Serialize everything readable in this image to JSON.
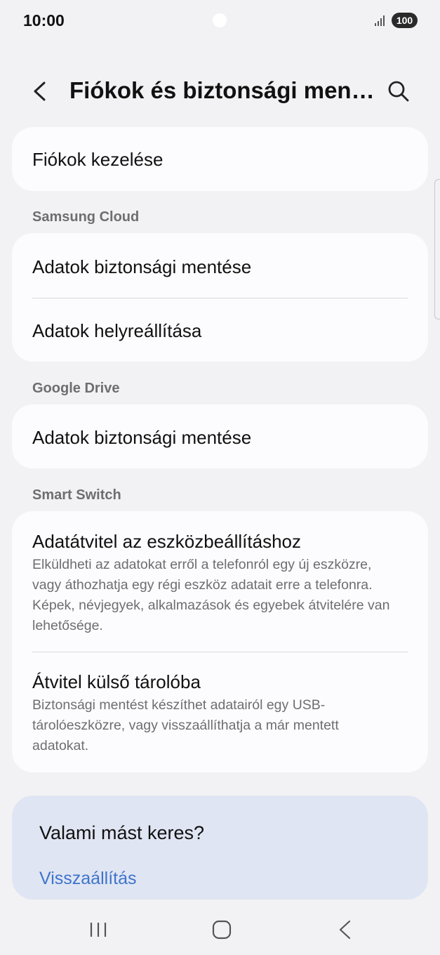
{
  "status_bar": {
    "time": "10:00",
    "battery": "100",
    "icons": [
      "signal-icon",
      "battery-icon"
    ]
  },
  "header": {
    "title": "Fiókok és biztonsági mentés",
    "back_icon": "chevron-left-icon",
    "search_icon": "search-icon"
  },
  "manage_card": {
    "title": "Fiókok kezelése"
  },
  "samsung_cloud": {
    "label": "Samsung Cloud",
    "items": [
      {
        "title": "Adatok biztonsági mentése"
      },
      {
        "title": "Adatok helyreállítása"
      }
    ]
  },
  "google_drive": {
    "label": "Google Drive",
    "items": [
      {
        "title": "Adatok biztonsági mentése"
      }
    ]
  },
  "smart_switch": {
    "label": "Smart Switch",
    "items": [
      {
        "title": "Adatátvitel az eszközbeállításhoz",
        "desc": "Elküldheti az adatokat erről a telefonról egy új eszközre, vagy áthozhatja egy régi eszköz adatait erre a telefonra. Képek, névjegyek, alkalmazások és egyebek átvitelére van lehetősége."
      },
      {
        "title": "Átvitel külső tárolóba",
        "desc": "Biztonsági mentést készíthet adatairól egy USB-tárolóeszközre, vagy visszaállíthatja a már mentett adatokat."
      }
    ]
  },
  "suggestion": {
    "title": "Valami mást keres?",
    "link": "Visszaállítás"
  },
  "nav_bar": {
    "buttons": [
      "recent-apps-icon",
      "home-icon",
      "back-icon"
    ]
  },
  "colors": {
    "background": "#f2f2f4",
    "card": "#fcfcfe",
    "suggestion_card": "#e0e5f3",
    "link": "#3e74cb",
    "secondary_text": "#6e6e72"
  }
}
